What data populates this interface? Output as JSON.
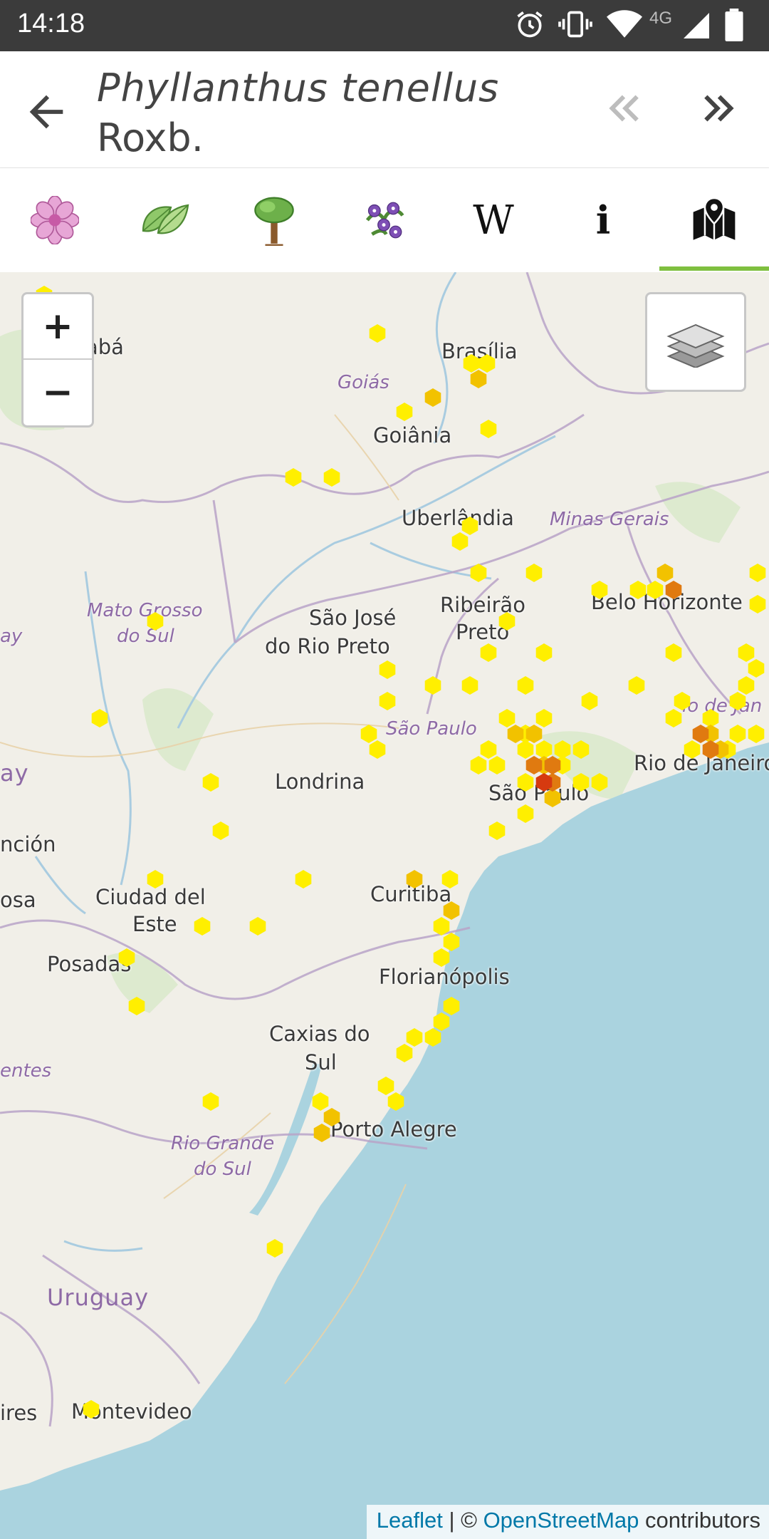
{
  "status_bar": {
    "time": "14:18",
    "network": "4G",
    "icons": [
      "alarm-icon",
      "vibrate-icon",
      "wifi-icon",
      "signal-icon",
      "battery-icon"
    ]
  },
  "header": {
    "title_species": "Phyllanthus tenellus",
    "title_author": "Roxb.",
    "back_icon": "arrow-left-icon",
    "prev_icon": "double-chevron-left-icon",
    "next_icon": "double-chevron-right-icon"
  },
  "tabs": [
    {
      "name": "flower",
      "icon": "flower-icon"
    },
    {
      "name": "leaf",
      "icon": "leaf-icon"
    },
    {
      "name": "tree",
      "icon": "tree-icon"
    },
    {
      "name": "plant",
      "icon": "plant-icon"
    },
    {
      "name": "wikipedia",
      "icon": "wikipedia-icon",
      "glyph": "W"
    },
    {
      "name": "info",
      "icon": "info-icon",
      "glyph": "i"
    },
    {
      "name": "map",
      "icon": "map-icon",
      "active": true
    }
  ],
  "colors": {
    "accent": "#7fbf3f",
    "hex_low": "#ffef00",
    "hex_mid": "#f2c200",
    "hex_high": "#e07a10",
    "hex_max": "#d63a10",
    "water": "#aad3df"
  },
  "map": {
    "zoom_in": "+",
    "zoom_out": "−",
    "layers_icon": "layers-icon",
    "labels": {
      "cuiaba": "abá",
      "brasilia": "Brasília",
      "goias": "Goiás",
      "goiania": "Goiânia",
      "uberlandia": "Uberlândia",
      "minas_gerais": "Minas Gerais",
      "mato_grosso_do_sul_1": "Mato Grosso",
      "mato_grosso_do_sul_2": "do Sul",
      "sao_jose_1": "São José",
      "sao_jose_2": "do Rio Preto",
      "ribeirao_1": "Ribeirão",
      "ribeirao_2": "Preto",
      "belo_horizonte": "Belo Horizonte",
      "paraguay": "ay",
      "paraguay_top": "ay",
      "sao_paulo_state": "São Paulo",
      "rio_state": "io de Jan",
      "rio": "Rio de Janeiro",
      "londrina": "Londrina",
      "sao_paulo": "São Paulo",
      "asuncion": "nción",
      "osa": "osa",
      "ciudad_1": "Ciudad del",
      "ciudad_2": "Este",
      "curitiba": "Curitiba",
      "posadas": "Posadas",
      "florianopolis": "Florianópolis",
      "caxias_1": "Caxias do",
      "caxias_2": "Sul",
      "entes": "entes",
      "porto_alegre": "Porto Alegre",
      "rio_grande_1": "Rio Grande",
      "rio_grande_2": "do Sul",
      "uruguay": "Uruguay",
      "aires": "ires",
      "montevideo": "Montevideo"
    },
    "attribution": {
      "leaflet": "Leaflet",
      "separator": " | © ",
      "osm": "OpenStreetMap",
      "suffix": " contributors"
    }
  }
}
